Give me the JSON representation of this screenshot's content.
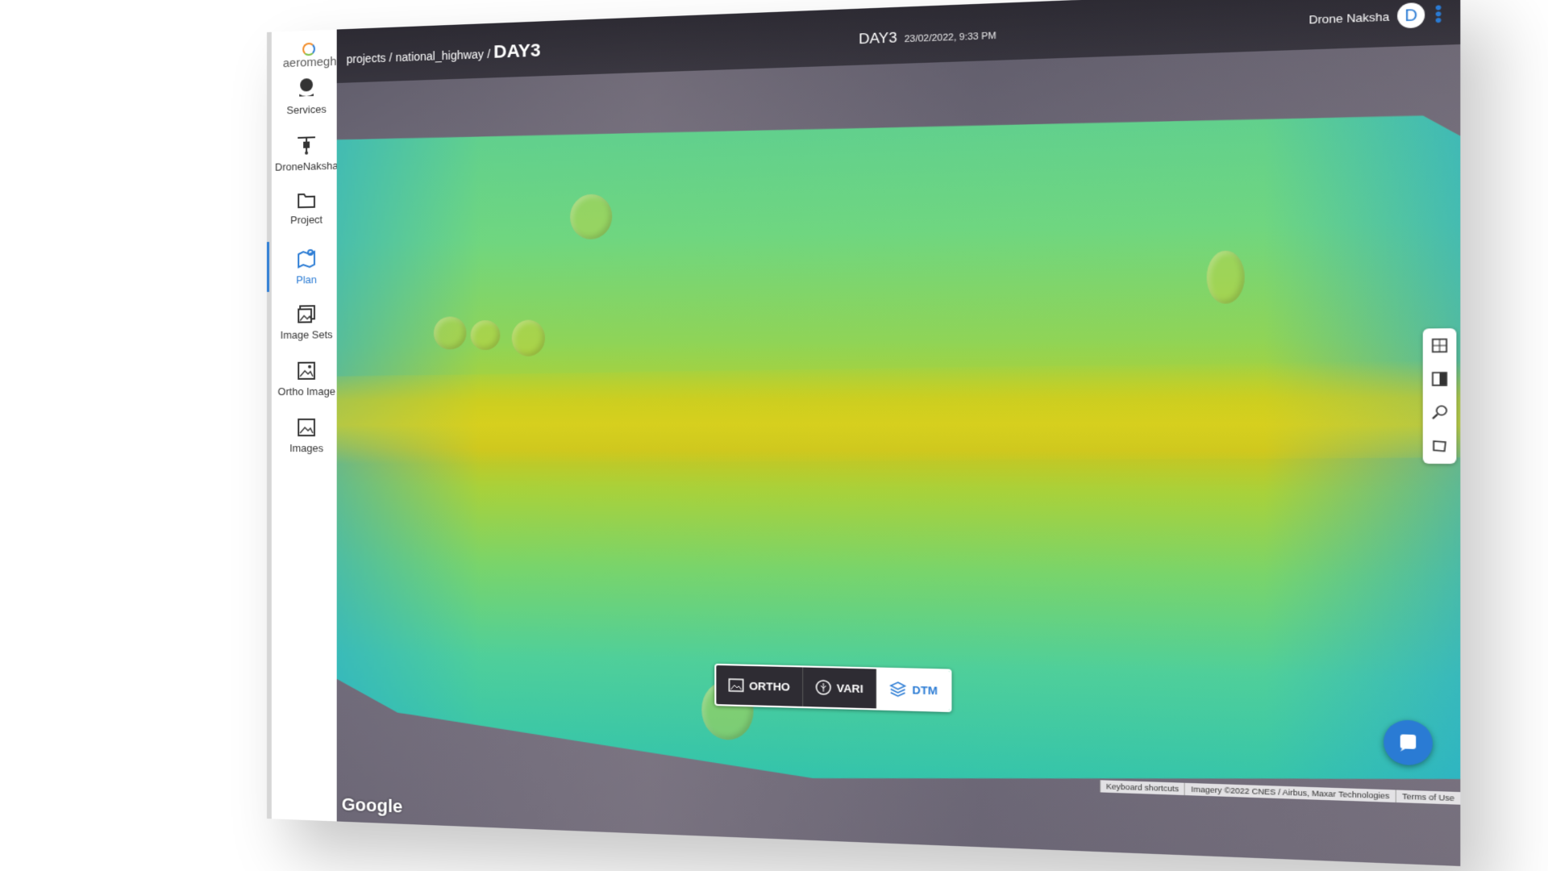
{
  "brand": {
    "name": "aeromegh"
  },
  "sidebar": {
    "items": [
      {
        "label": "Services",
        "icon": "services-icon"
      },
      {
        "label": "DroneNaksha",
        "icon": "drone-icon"
      },
      {
        "label": "Project",
        "icon": "folder-icon"
      },
      {
        "label": "Plan",
        "icon": "map-plan-icon",
        "active": true
      },
      {
        "label": "Image Sets",
        "icon": "image-sets-icon"
      },
      {
        "label": "Ortho Image",
        "icon": "ortho-image-icon"
      },
      {
        "label": "Images",
        "icon": "images-icon"
      }
    ]
  },
  "header": {
    "breadcrumb": {
      "projects": "projects",
      "project": "national_highway",
      "sep": "/",
      "current": "DAY3"
    },
    "title": "DAY3",
    "timestamp": "23/02/2022, 9:33 PM",
    "user_name": "Drone Naksha",
    "avatar_letter": "D"
  },
  "map_tools": [
    "layers-icon",
    "compare-icon",
    "zoom-icon",
    "measure-area-icon"
  ],
  "layers": {
    "ortho": "ORTHO",
    "vari": "VARI",
    "dtm": "DTM",
    "active": "DTM"
  },
  "attribution": {
    "shortcuts": "Keyboard shortcuts",
    "imagery": "Imagery ©2022 CNES / Airbus, Maxar Technologies",
    "terms": "Terms of Use"
  },
  "google_logo": "Google",
  "colors": {
    "accent": "#2a7bd4",
    "topbar": "#2e2c33"
  }
}
